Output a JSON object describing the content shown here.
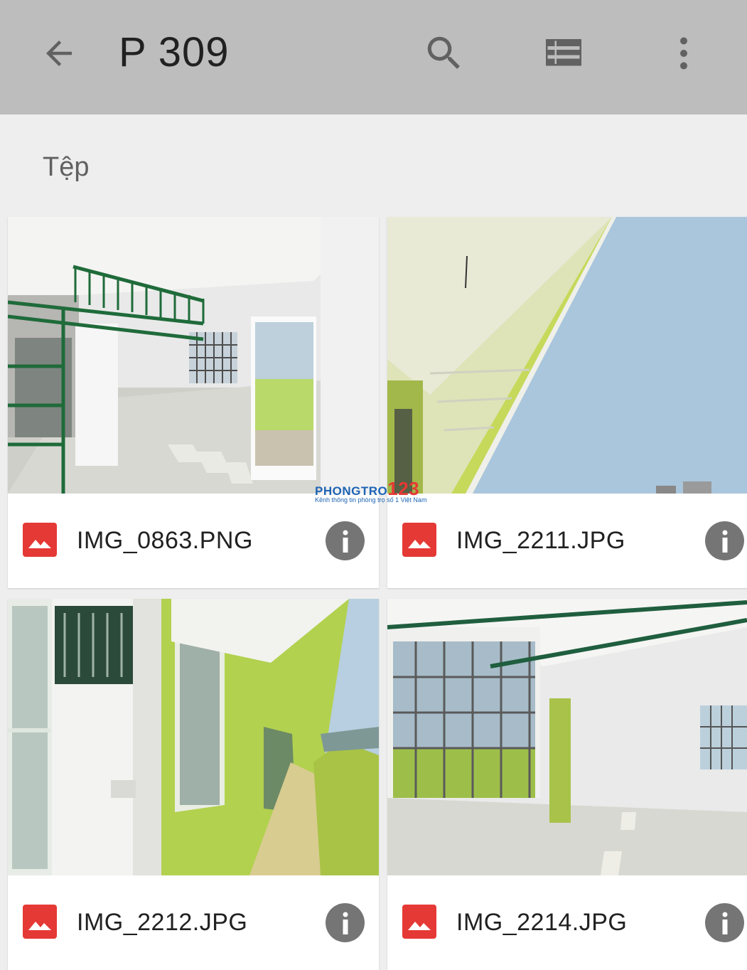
{
  "appbar": {
    "back_icon": "arrow-back-icon",
    "title": "P 309",
    "search_icon": "search-icon",
    "list_view_icon": "view-list-icon",
    "more_icon": "more-vert-icon"
  },
  "section": {
    "label": "Tệp"
  },
  "files": [
    {
      "name": "IMG_0863.PNG",
      "type_icon": "image-file-icon",
      "info_icon": "info-icon"
    },
    {
      "name": "IMG_2211.JPG",
      "type_icon": "image-file-icon",
      "info_icon": "info-icon"
    },
    {
      "name": "IMG_2212.JPG",
      "type_icon": "image-file-icon",
      "info_icon": "info-icon"
    },
    {
      "name": "IMG_2214.JPG",
      "type_icon": "image-file-icon",
      "info_icon": "info-icon"
    }
  ],
  "watermark": {
    "brand": "PHONGTRO",
    "brand_number": "123",
    "tagline": "Kênh thông tin phòng trọ số 1 Việt Nam"
  },
  "colors": {
    "appbar_bg": "#bdbdbd",
    "page_bg": "#eeeeee",
    "image_icon_red": "#e53935",
    "info_grey": "#757575"
  }
}
